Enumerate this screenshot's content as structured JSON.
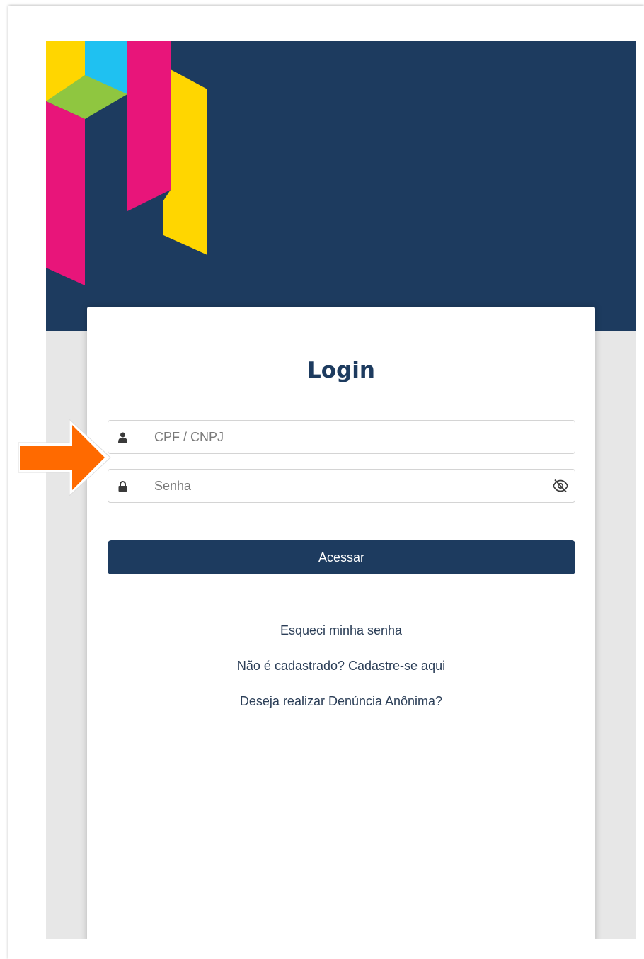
{
  "login": {
    "title": "Login",
    "cpf_placeholder": "CPF / CNPJ",
    "senha_placeholder": "Senha",
    "submit_label": "Acessar"
  },
  "links": {
    "forgot_password": "Esqueci minha senha",
    "register": "Não é cadastrado? Cadastre-se aqui",
    "anonymous_report": "Deseja realizar Denúncia Anônima?"
  },
  "icons": {
    "cpf_field": "user-icon",
    "senha_field": "lock-icon",
    "toggle_password": "eye-slash-icon",
    "annotation": "arrow-right-icon"
  },
  "colors": {
    "brand_navy": "#1d3b5f",
    "logo_magenta": "#e8157a",
    "logo_yellow": "#ffd600",
    "logo_cyan": "#1fc1f1",
    "logo_green": "#8fc640",
    "annotation_orange": "#ff6a00"
  }
}
